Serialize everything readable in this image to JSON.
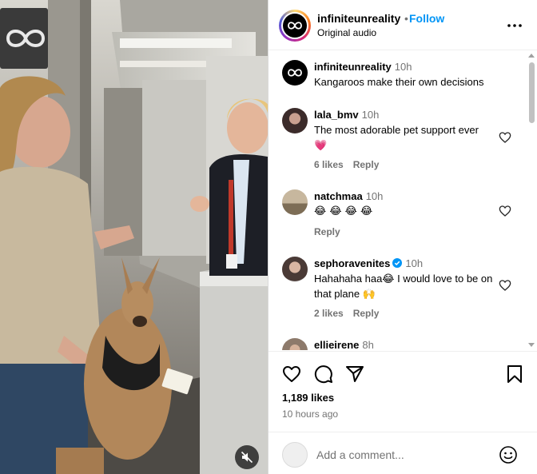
{
  "post": {
    "username": "infiniteunreality",
    "separator": "•",
    "follow_label": "Follow",
    "audio": "Original audio",
    "caption": {
      "username": "infiniteunreality",
      "time": "10h",
      "text": "Kangaroos make their own decisions"
    },
    "likes": "1,189 likes",
    "posted": "10 hours ago"
  },
  "comments": [
    {
      "username": "lala_bmv",
      "time": "10h",
      "text": "The most adorable pet support ever",
      "emoji": "💗",
      "likes": "6 likes",
      "reply": "Reply"
    },
    {
      "username": "natchmaa",
      "time": "10h",
      "text": "😂 😂 😂 😂",
      "reply": "Reply"
    },
    {
      "username": "sephoravenites",
      "time": "10h",
      "verified": true,
      "text": "Hahahaha haa😂 I would love to be on that plane 🙌",
      "likes": "2 likes",
      "reply": "Reply"
    },
    {
      "username": "ellieirene",
      "time": "8h"
    }
  ],
  "add_comment": {
    "placeholder": "Add a comment..."
  },
  "icons": {
    "more": "more-options-icon",
    "like": "heart-icon",
    "comment": "comment-bubble-icon",
    "share": "paper-plane-icon",
    "save": "bookmark-icon",
    "emoji": "smiley-icon",
    "mute": "speaker-muted-icon"
  },
  "colors": {
    "link": "#0095f6",
    "secondary": "#737373",
    "heart": "#ff3040"
  }
}
